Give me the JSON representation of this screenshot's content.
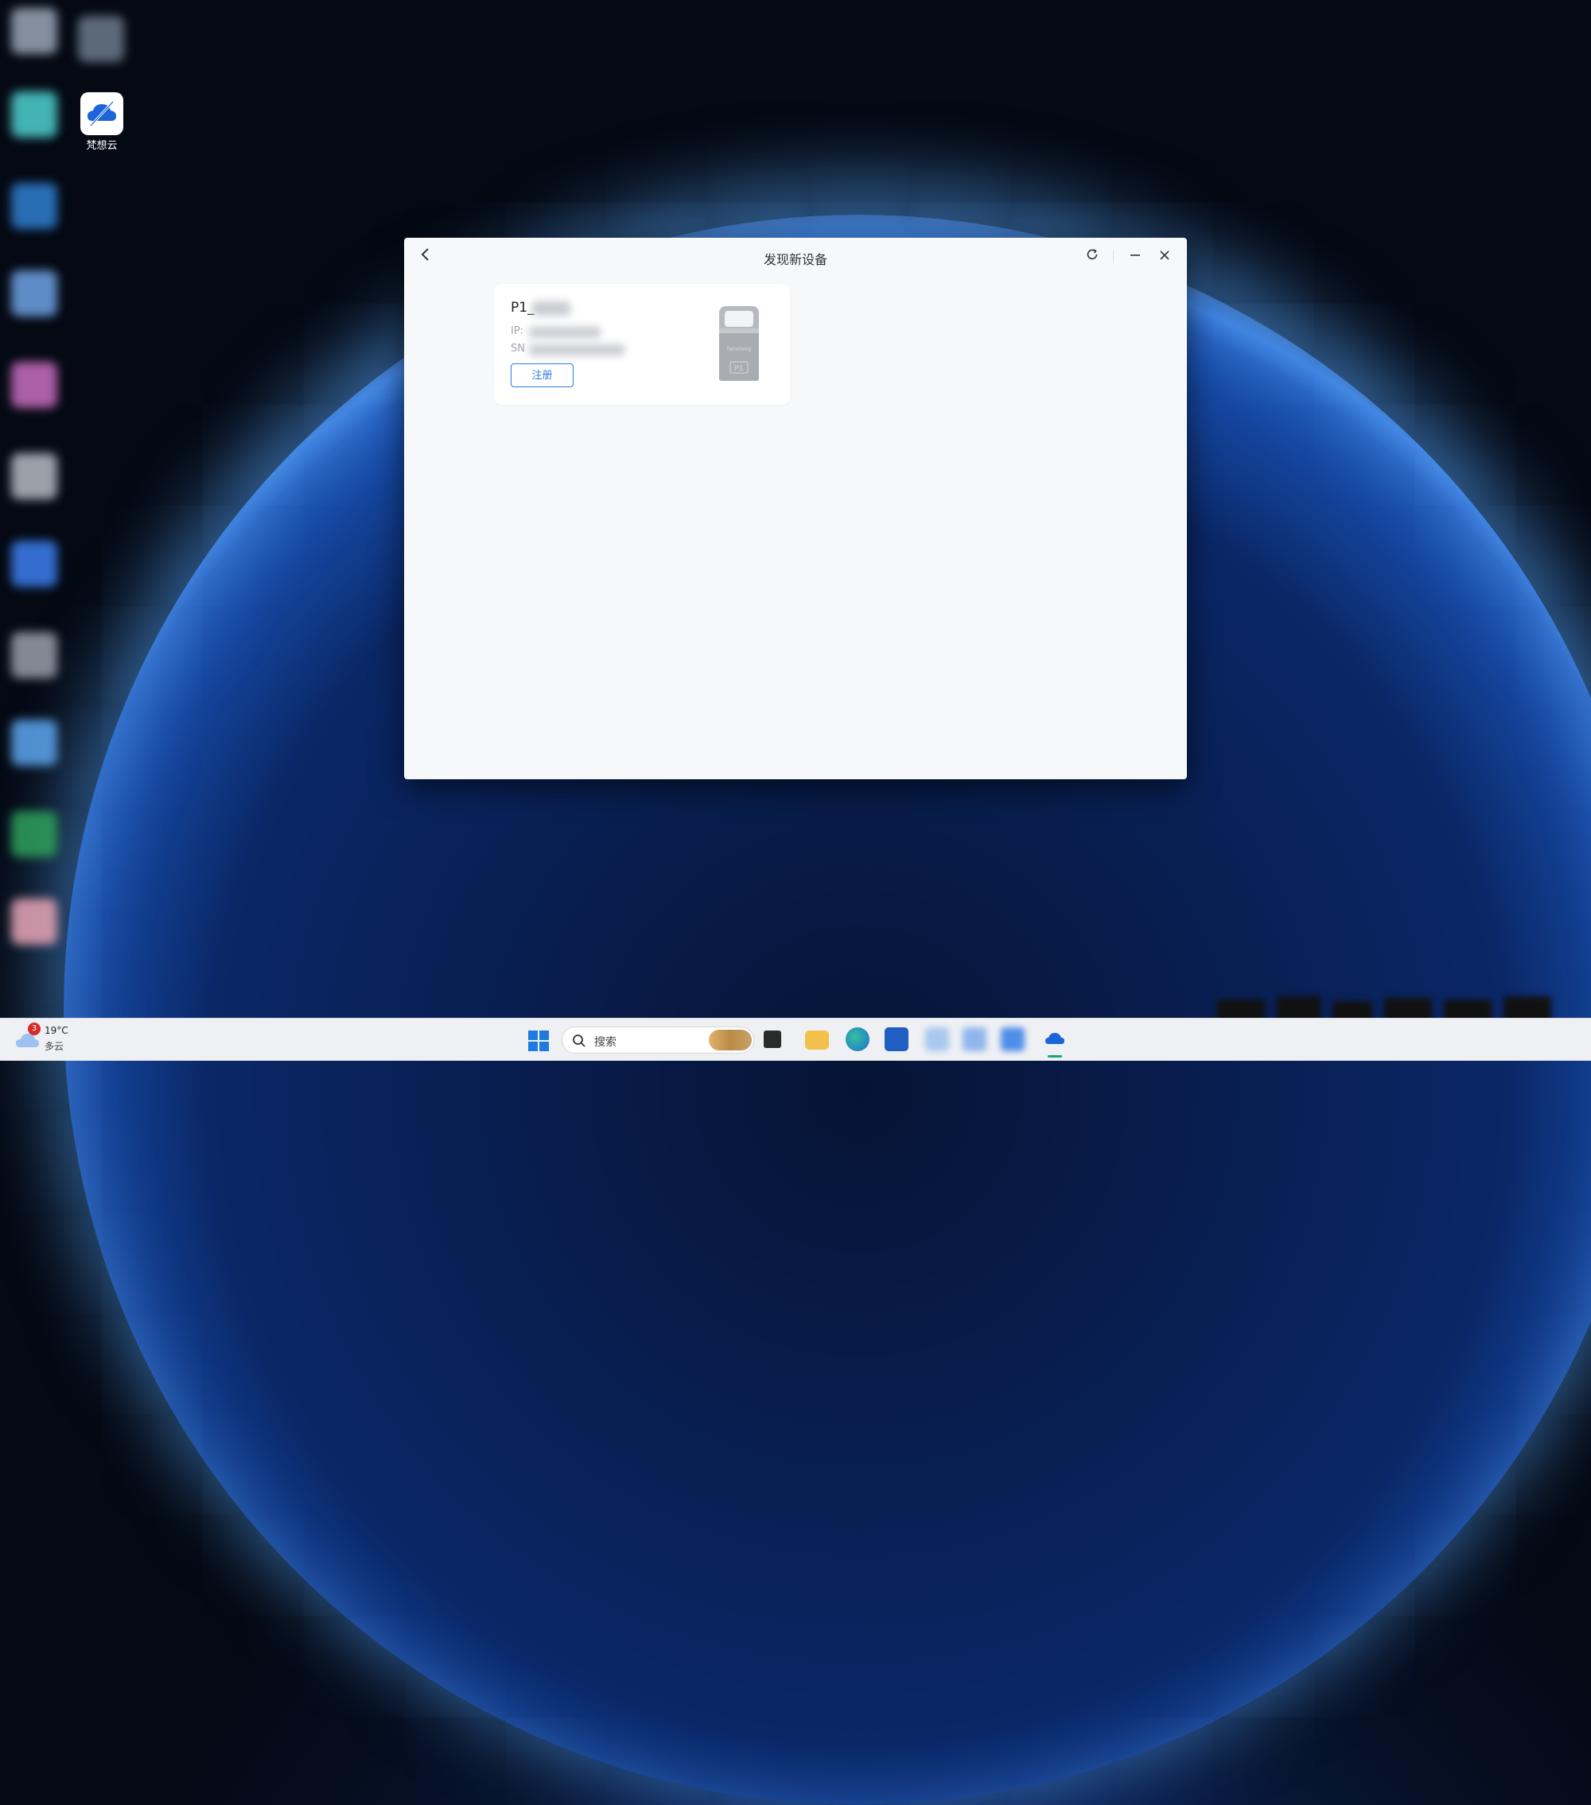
{
  "desktop": {
    "shortcut_label": "梵想云"
  },
  "window": {
    "title": "发现新设备",
    "back_icon": "chevron-left-icon",
    "refresh_icon": "refresh-icon",
    "minimize_icon": "minimize-icon",
    "close_icon": "close-icon"
  },
  "device_card": {
    "name": "P1_",
    "ip_label": "IP:",
    "sn_label": "SN",
    "register_label": "注册",
    "image_brand": "fanxiang",
    "image_model": "P1"
  },
  "taskbar": {
    "weather_temp": "19°C",
    "weather_desc": "多云",
    "notification_count": "3",
    "search_placeholder": "搜索",
    "accent": "#2d7be5"
  }
}
